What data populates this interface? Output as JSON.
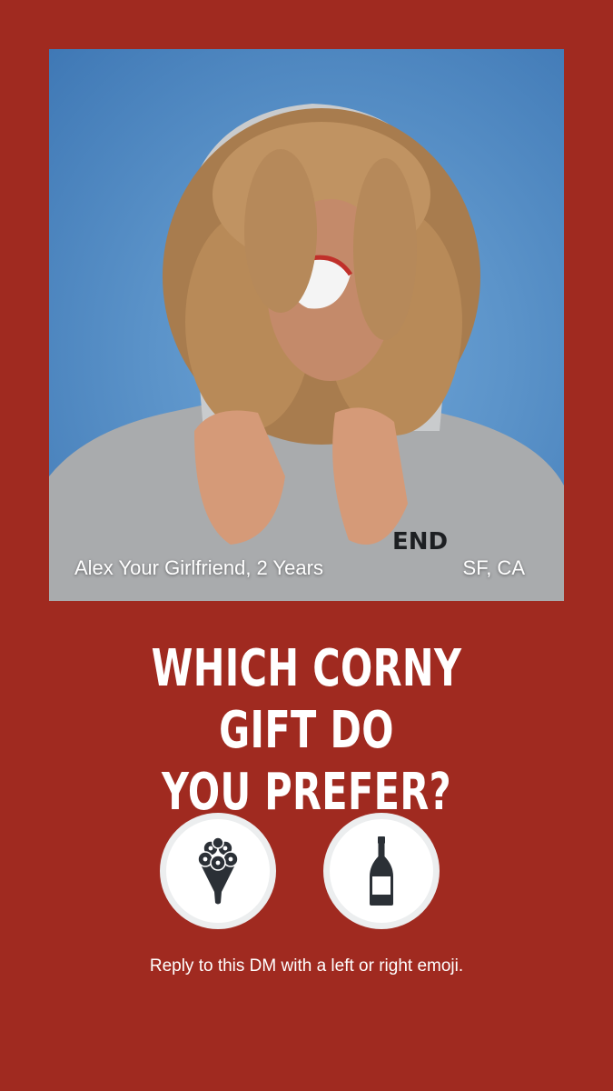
{
  "profile": {
    "name_line": "Alex Your Girlfriend, 2 Years",
    "location": "SF, CA"
  },
  "question": {
    "line1": "WHICH CORNY GIFT DO",
    "line2": "YOU PREFER?"
  },
  "options": [
    {
      "icon": "flower-bouquet-icon"
    },
    {
      "icon": "champagne-bottle-icon"
    }
  ],
  "footer": {
    "text": "Reply to this DM with a left or right emoji."
  },
  "colors": {
    "background": "#a02a20",
    "photo_background": "#5b93c9",
    "icon": "#2b3036",
    "text": "#ffffff"
  }
}
